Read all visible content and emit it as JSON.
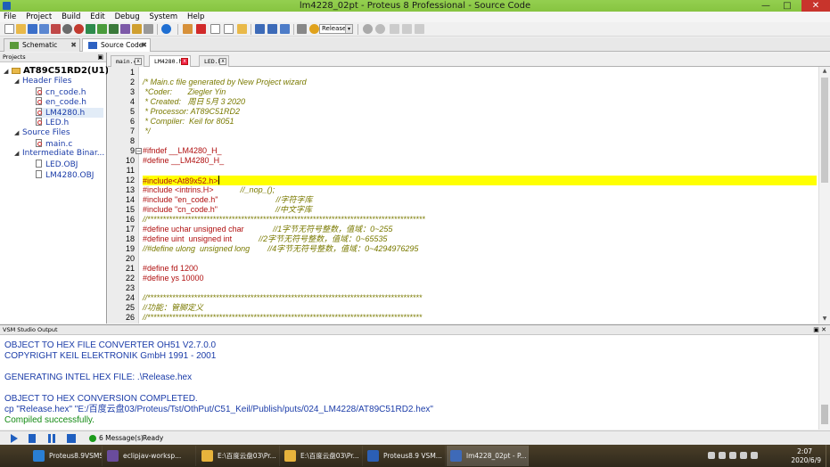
{
  "window": {
    "title": "lm4228_02pt - Proteus 8 Professional - Source Code",
    "minimize_glyph": "—",
    "maximize_glyph": "□",
    "close_glyph": "✕"
  },
  "menu": {
    "items": [
      "File",
      "Project",
      "Build",
      "Edit",
      "Debug",
      "System",
      "Help"
    ]
  },
  "toolbar": {
    "config_select_value": "Release",
    "select_arrow": "▾"
  },
  "main_tabs": [
    {
      "label": "Schematic Capture",
      "close": "✖"
    },
    {
      "label": "Source Code",
      "close": "✖"
    }
  ],
  "projects": {
    "header": "Projects",
    "pin": "▣",
    "root": "AT89C51RD2(U1)",
    "expand_glyph": "◢",
    "groups": [
      {
        "label": "Header Files",
        "files": [
          "cn_code.h",
          "en_code.h",
          "LM4280.h",
          "LED.h"
        ]
      },
      {
        "label": "Source Files",
        "files": [
          "main.c"
        ]
      },
      {
        "label": "Intermediate Binar...",
        "files": [
          "LED.OBJ",
          "LM4280.OBJ"
        ]
      }
    ]
  },
  "editor_tabs": [
    {
      "label": "main.c",
      "close": "x"
    },
    {
      "label": "LM4280.h",
      "close": "x"
    },
    {
      "label": "LED.h",
      "close": "x"
    }
  ],
  "editor": {
    "fold_glyph": "−",
    "lines": [
      {
        "n": "1",
        "text": "",
        "cls": ""
      },
      {
        "n": "2",
        "text": "/* Main.c file generated by New Project wizard",
        "cls": "cm"
      },
      {
        "n": "3",
        "text": " *Coder:       Ziegler Yin",
        "cls": "cm"
      },
      {
        "n": "4",
        "text": " * Created:   周日 5月 3 2020",
        "cls": "cm"
      },
      {
        "n": "5",
        "text": " * Processor: AT89C51RD2",
        "cls": "cm"
      },
      {
        "n": "6",
        "text": " * Compiler:  Keil for 8051",
        "cls": "cm"
      },
      {
        "n": "7",
        "text": " */",
        "cls": "cm"
      },
      {
        "n": "8",
        "text": "",
        "cls": ""
      },
      {
        "n": "9",
        "text": "#ifndef __LM4280_H_",
        "cls": "pp"
      },
      {
        "n": "10",
        "text": "#define __LM4280_H_",
        "cls": "pp"
      },
      {
        "n": "11",
        "text": "",
        "cls": ""
      },
      {
        "n": "12",
        "text": "#include<At89x52.h>",
        "cls": "pp hl"
      },
      {
        "n": "13",
        "text": "#include <intrins.H>",
        "cls": "pp",
        "comment": "            //_nop_();"
      },
      {
        "n": "14",
        "text": "#include \"en_code.h\"",
        "cls": "pp",
        "comment": "                          //字符字库"
      },
      {
        "n": "15",
        "text": "#include \"cn_code.h\"",
        "cls": "pp",
        "comment": "                          //中文字库"
      },
      {
        "n": "16",
        "text": "//*****************************************************************************************",
        "cls": "cm"
      },
      {
        "n": "17",
        "text": "#define uchar unsigned char",
        "cls": "pp",
        "comment": "             //1字节无符号整数，值域：0~255"
      },
      {
        "n": "18",
        "text": "#define uint  unsigned int",
        "cls": "pp",
        "comment": "            //2字节无符号整数，值域：0~65535"
      },
      {
        "n": "19",
        "text": "//#define ulong  unsigned long",
        "cls": "cm",
        "comment": "        //4字节无符号整数，值域：0~4294976295"
      },
      {
        "n": "20",
        "text": "",
        "cls": ""
      },
      {
        "n": "21",
        "text": "#define fd 1200",
        "cls": "pp"
      },
      {
        "n": "22",
        "text": "#define ys 10000",
        "cls": "pp"
      },
      {
        "n": "23",
        "text": "",
        "cls": ""
      },
      {
        "n": "24",
        "text": "//****************************************************************************************",
        "cls": "cm"
      },
      {
        "n": "25",
        "text": "//功能：管脚定义",
        "cls": "cm"
      },
      {
        "n": "26",
        "text": "//****************************************************************************************",
        "cls": "cm"
      }
    ]
  },
  "output": {
    "header": "VSM Studio Output",
    "controls": "▣ ✕",
    "lines": [
      {
        "text": "OBJECT TO HEX FILE CONVERTER OH51 V2.7.0.0",
        "cls": ""
      },
      {
        "text": "COPYRIGHT KEIL ELEKTRONIK GmbH 1991 - 2001",
        "cls": ""
      },
      {
        "text": "",
        "cls": ""
      },
      {
        "text": "GENERATING INTEL HEX FILE: .\\Release.hex",
        "cls": ""
      },
      {
        "text": "",
        "cls": ""
      },
      {
        "text": "OBJECT TO HEX CONVERSION COMPLETED.",
        "cls": ""
      },
      {
        "text": "cp \"Release.hex\" \"E:/百度云盘03/Proteus/Tst/OthPut/C51_Keil/Publish/puts/024_LM4228/AT89C51RD2.hex\"",
        "cls": ""
      },
      {
        "text": "Compiled successfully.",
        "cls": "green"
      }
    ]
  },
  "status": {
    "messages": "6 Message(s)",
    "state": "Ready"
  },
  "taskbar": {
    "items": [
      {
        "label": "Proteus8.9VSMS...",
        "color": "#2a7fd4"
      },
      {
        "label": "eclipjav-worksp...",
        "color": "#6a4c9c"
      },
      {
        "label": "E:\\百度云盘03\\Pr...",
        "color": "#e7b33c"
      },
      {
        "label": "E:\\百度云盘03\\Pr...",
        "color": "#e7b33c"
      },
      {
        "label": "Proteus8.9 VSM...",
        "color": "#2b5fb5"
      },
      {
        "label": "lm4228_02pt - P...",
        "color": "#3e6ab8"
      }
    ],
    "time": "2:07",
    "date": "2020/6/9"
  }
}
